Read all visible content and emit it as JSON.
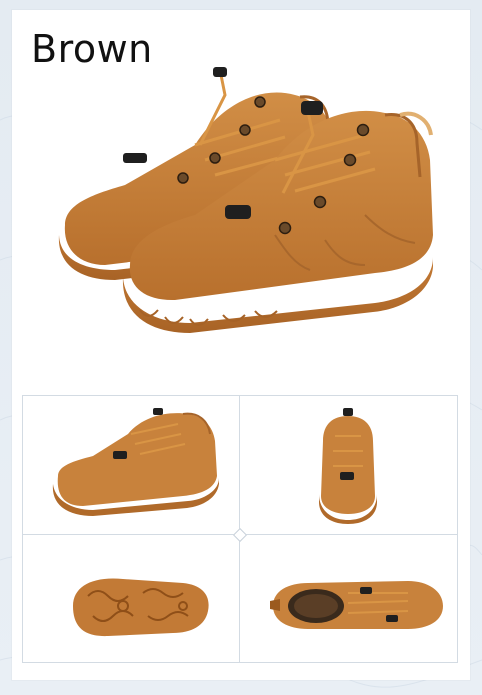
{
  "title": "Brown",
  "colors": {
    "leather": "#c8823c",
    "leather_dark": "#9b5a1f",
    "sole": "#b86f2c",
    "lace": "#d99545",
    "toggle": "#1f1f1f",
    "eyelet": "#6a4a2a"
  },
  "views": [
    "side-view",
    "back-view",
    "sole-view",
    "top-view"
  ]
}
